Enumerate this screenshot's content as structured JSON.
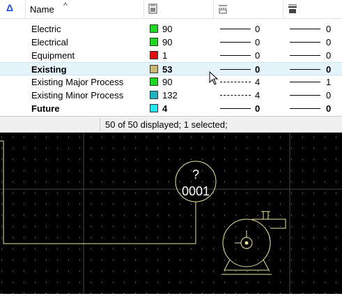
{
  "columns": {
    "name_label": "Name",
    "sort_indicator": "^",
    "filter_icon": "delta-icon",
    "color_icon": "color-column-icon",
    "style_icon": "line-style-column-icon",
    "weight_icon": "line-weight-column-icon"
  },
  "levels": [
    {
      "name": "Electric",
      "color": "#1fd81f",
      "color_value": "90",
      "style": "solid",
      "style_value": "0",
      "weight_value": "0",
      "bold": false,
      "selected": false
    },
    {
      "name": "Electrical",
      "color": "#1fd81f",
      "color_value": "90",
      "style": "solid",
      "style_value": "0",
      "weight_value": "0",
      "bold": false,
      "selected": false
    },
    {
      "name": "Equipment",
      "color": "#e01010",
      "color_value": "1",
      "style": "solid",
      "style_value": "0",
      "weight_value": "0",
      "bold": false,
      "selected": false
    },
    {
      "name": "Existing",
      "color": "#c9b871",
      "color_value": "53",
      "style": "solid",
      "style_value": "0",
      "weight_value": "0",
      "bold": true,
      "selected": true
    },
    {
      "name": "Existing Major Process",
      "color": "#1fd81f",
      "color_value": "90",
      "style": "dashdot",
      "style_value": "4",
      "weight_value": "1",
      "bold": false,
      "selected": false
    },
    {
      "name": "Existing Minor Process",
      "color": "#1fb3c7",
      "color_value": "132",
      "style": "dashdot",
      "style_value": "4",
      "weight_value": "0",
      "bold": false,
      "selected": false
    },
    {
      "name": "Future",
      "color": "#22e6f0",
      "color_value": "4",
      "style": "solid",
      "style_value": "0",
      "weight_value": "0",
      "bold": true,
      "selected": false
    }
  ],
  "status": {
    "text": "50 of 50 displayed; 1 selected;"
  },
  "drawing": {
    "tag_top": "?",
    "tag_bottom": "0001",
    "background": "#000000",
    "line_color": "#e8e8a0",
    "grid_dot_color": "#9a9a9a"
  }
}
